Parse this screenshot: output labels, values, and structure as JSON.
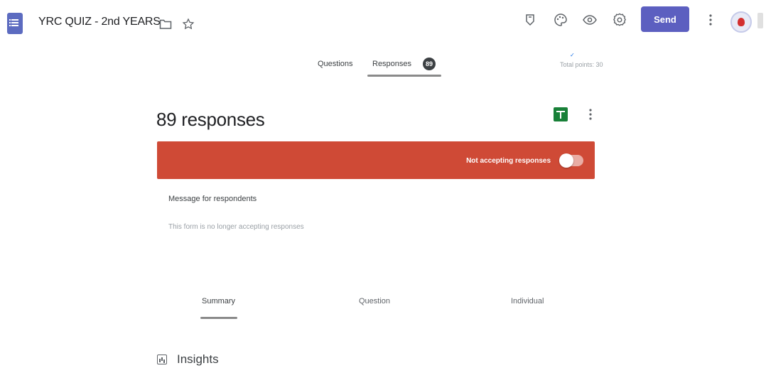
{
  "header": {
    "title": "YRC QUIZ - 2nd YEARS",
    "send_label": "Send",
    "icons": [
      "forms-logo-icon",
      "folder-icon",
      "star-icon",
      "addon-icon",
      "palette-icon",
      "eye-icon",
      "gear-icon",
      "more-vert-icon",
      "avatar"
    ]
  },
  "tabs": {
    "questions_label": "Questions",
    "responses_label": "Responses",
    "responses_badge": "89",
    "total_points": "Total points: 30"
  },
  "responses": {
    "count_label": "89 responses",
    "banner_label": "Not accepting responses",
    "banner_color": "#cf4a36",
    "accepting": false,
    "message_label": "Message for respondents",
    "message_text": "This form is no longer accepting responses"
  },
  "subtabs": {
    "summary_label": "Summary",
    "question_label": "Question",
    "individual_label": "Individual"
  },
  "insights": {
    "label": "Insights"
  },
  "colors": {
    "accent": "#5c5fc0",
    "sheets_green": "#188038"
  }
}
